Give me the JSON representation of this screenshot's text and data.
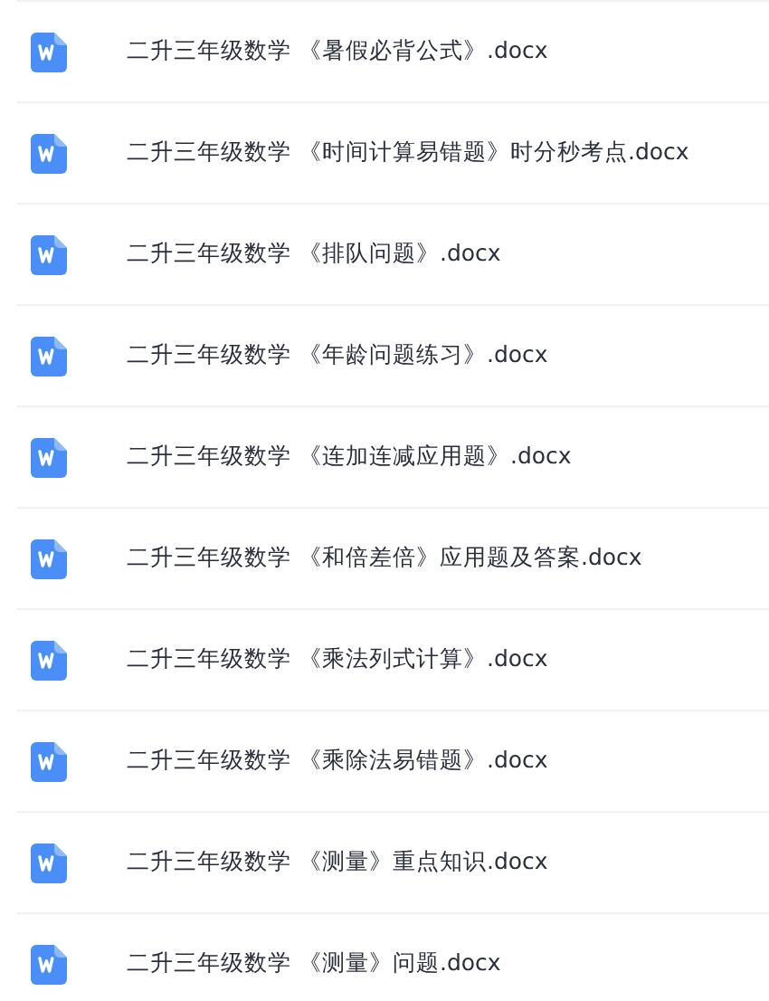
{
  "files": [
    {
      "name": "二升三年级数学 《暑假必背公式》.docx"
    },
    {
      "name": "二升三年级数学 《时间计算易错题》时分秒考点.docx"
    },
    {
      "name": "二升三年级数学 《排队问题》.docx"
    },
    {
      "name": "二升三年级数学 《年龄问题练习》.docx"
    },
    {
      "name": "二升三年级数学 《连加连减应用题》.docx"
    },
    {
      "name": "二升三年级数学 《和倍差倍》应用题及答案.docx"
    },
    {
      "name": "二升三年级数学 《乘法列式计算》.docx"
    },
    {
      "name": "二升三年级数学 《乘除法易错题》.docx"
    },
    {
      "name": "二升三年级数学 《测量》重点知识.docx"
    },
    {
      "name": "二升三年级数学 《测量》问题.docx"
    }
  ]
}
